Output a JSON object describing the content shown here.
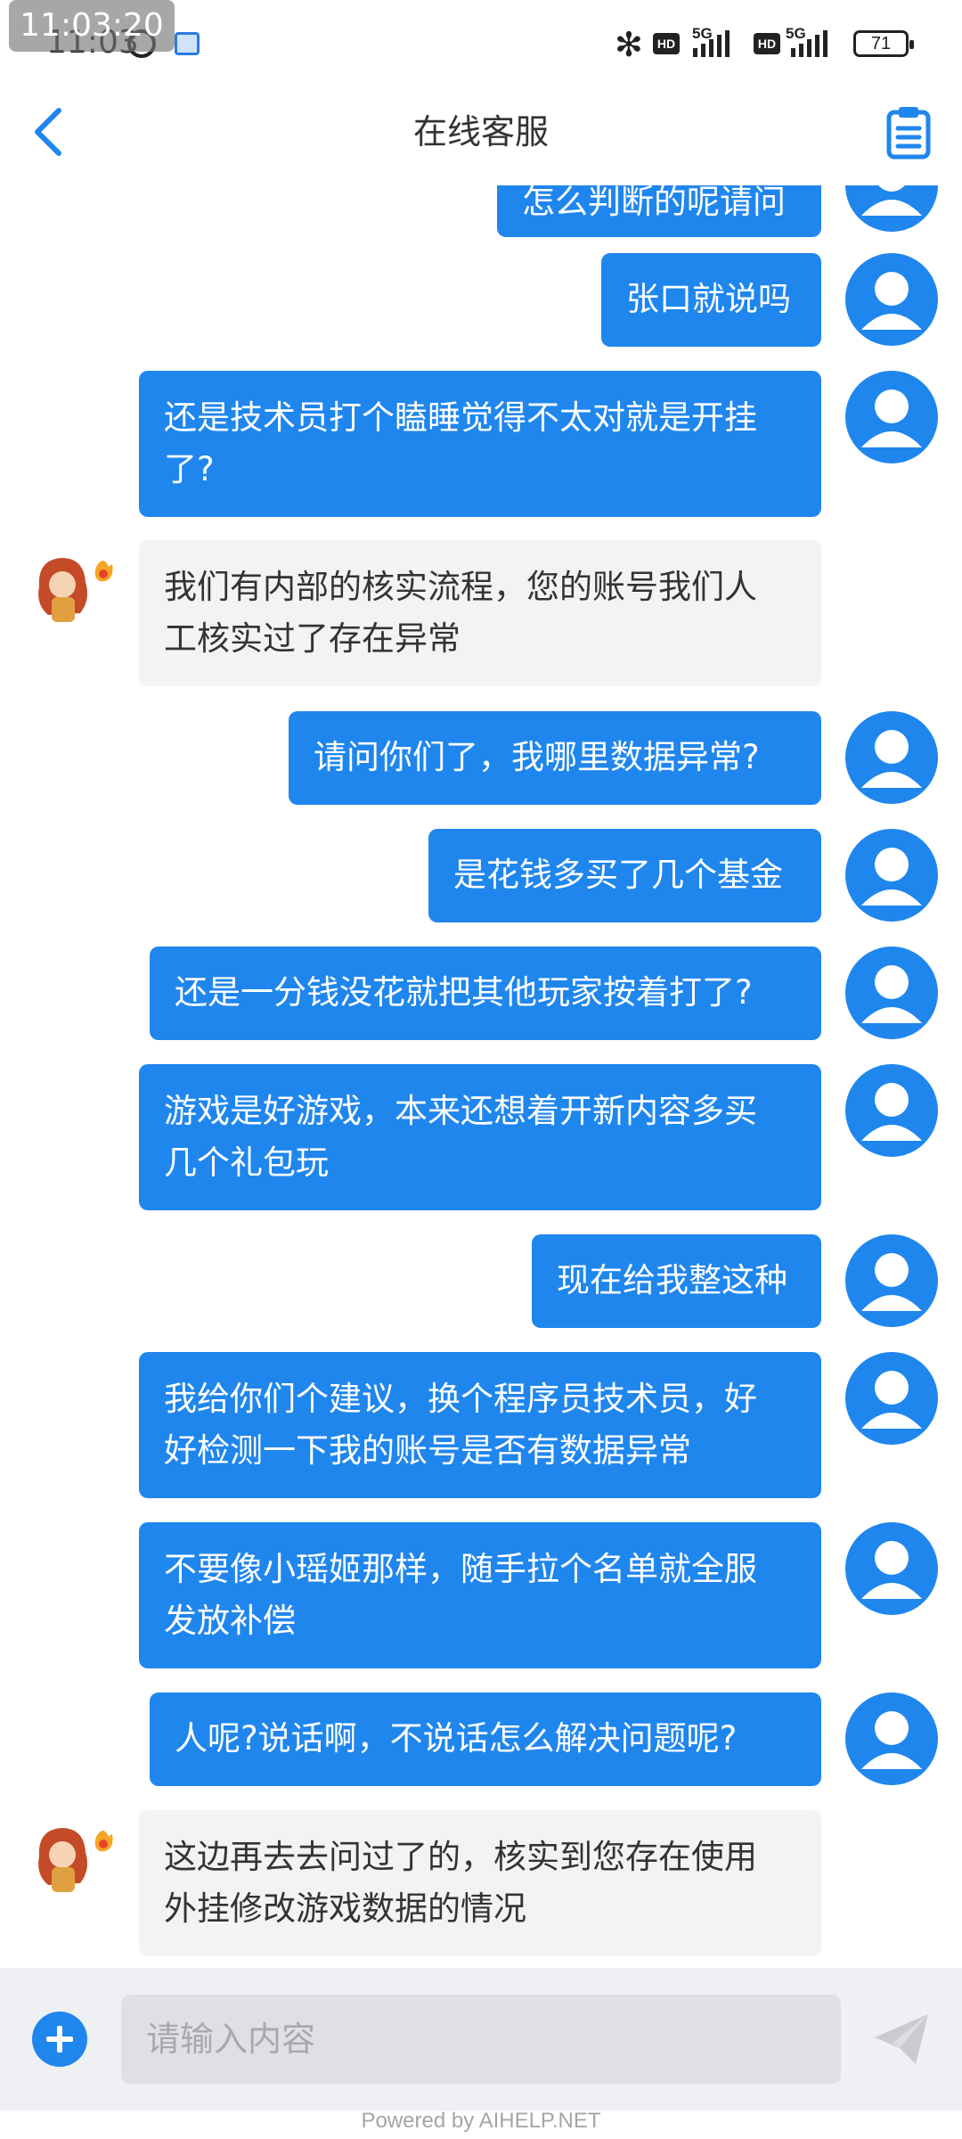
{
  "status_bar": {
    "time_overlay": "11:03:20",
    "clock": "11:03",
    "net1": "5G",
    "net2": "5G",
    "hd": "HD",
    "battery": "71"
  },
  "header": {
    "title": "在线客服",
    "back_icon": "chevron-left-icon",
    "right_icon": "clipboard-icon"
  },
  "messages": [
    {
      "sender": "user",
      "text": "怎么判断的呢请问"
    },
    {
      "sender": "user",
      "text": "张口就说吗"
    },
    {
      "sender": "user",
      "line1": "还是技术员打个瞌睡觉得不太对就是开挂",
      "line2": "了?"
    },
    {
      "sender": "agent",
      "line1": "我们有内部的核实流程，您的账号我们人",
      "line2": "工核实过了存在异常"
    },
    {
      "sender": "user",
      "text": "请问你们了，我哪里数据异常?"
    },
    {
      "sender": "user",
      "text": "是花钱多买了几个基金"
    },
    {
      "sender": "user",
      "text": "还是一分钱没花就把其他玩家按着打了?"
    },
    {
      "sender": "user",
      "line1": "游戏是好游戏，本来还想着开新内容多买",
      "line2": "几个礼包玩"
    },
    {
      "sender": "user",
      "text": "现在给我整这种"
    },
    {
      "sender": "user",
      "line1": "我给你们个建议，换个程序员技术员，好",
      "line2": "好检测一下我的账号是否有数据异常"
    },
    {
      "sender": "user",
      "line1": "不要像小瑶姬那样，随手拉个名单就全服",
      "line2": "发放补偿"
    },
    {
      "sender": "user",
      "text": "人呢?说话啊，不说话怎么解决问题呢?"
    },
    {
      "sender": "agent",
      "line1": "这边再去去问过了的，核实到您存在使用",
      "line2": "外挂修改游戏数据的情况"
    }
  ],
  "input": {
    "placeholder": "请输入内容",
    "value": ""
  },
  "footer": {
    "powered_by": "Powered by AIHELP.NET"
  },
  "colors": {
    "accent": "#1f86ee",
    "agent_bubble": "#f2f3f5",
    "input_bar": "#eef0f3"
  }
}
